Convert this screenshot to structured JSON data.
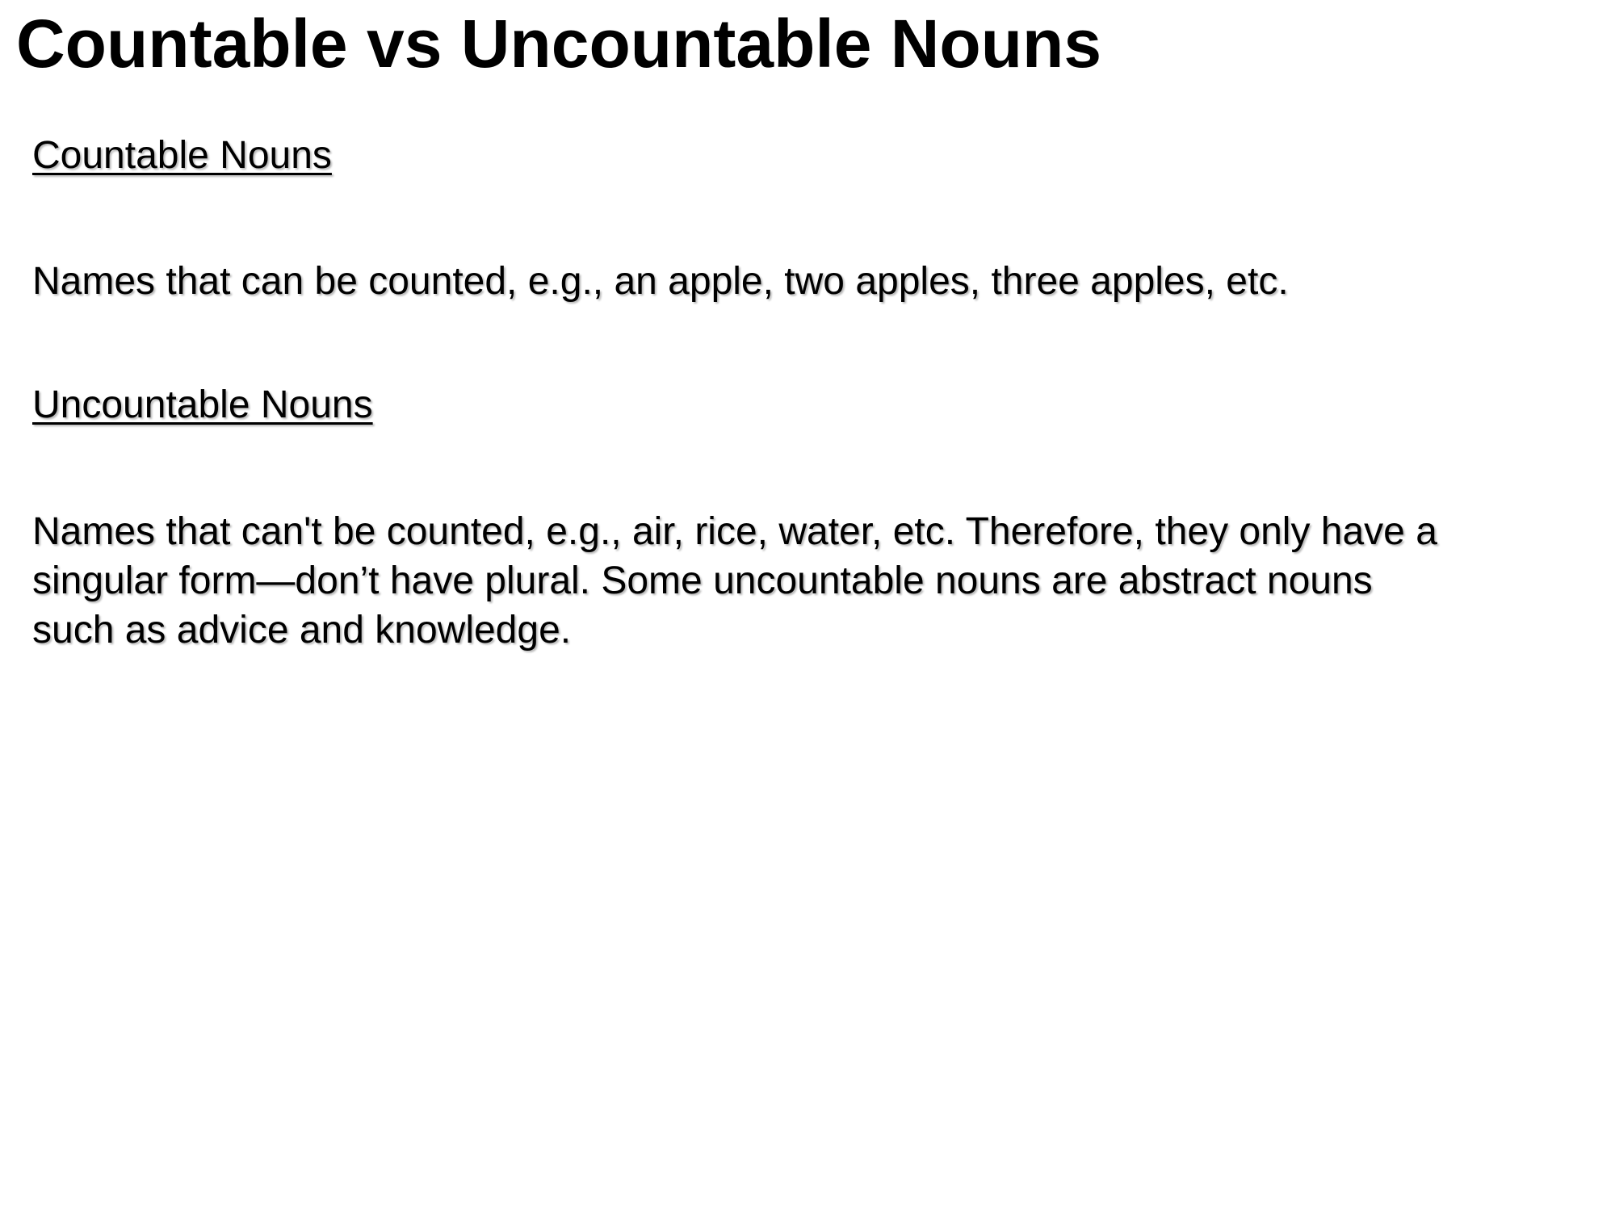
{
  "slide": {
    "title": "Countable vs Uncountable Nouns",
    "sections": [
      {
        "heading": "Countable Nouns",
        "text": "Names that can be counted, e.g., an apple, two apples, three apples, etc."
      },
      {
        "heading": "Uncountable Nouns",
        "lines": [
          "Names that can't be counted, e.g., air, rice, water, etc. Therefore, they only have a",
          "singular form—don’t have plural. Some uncountable nouns are abstract nouns",
          "such as advice and knowledge."
        ]
      }
    ]
  }
}
